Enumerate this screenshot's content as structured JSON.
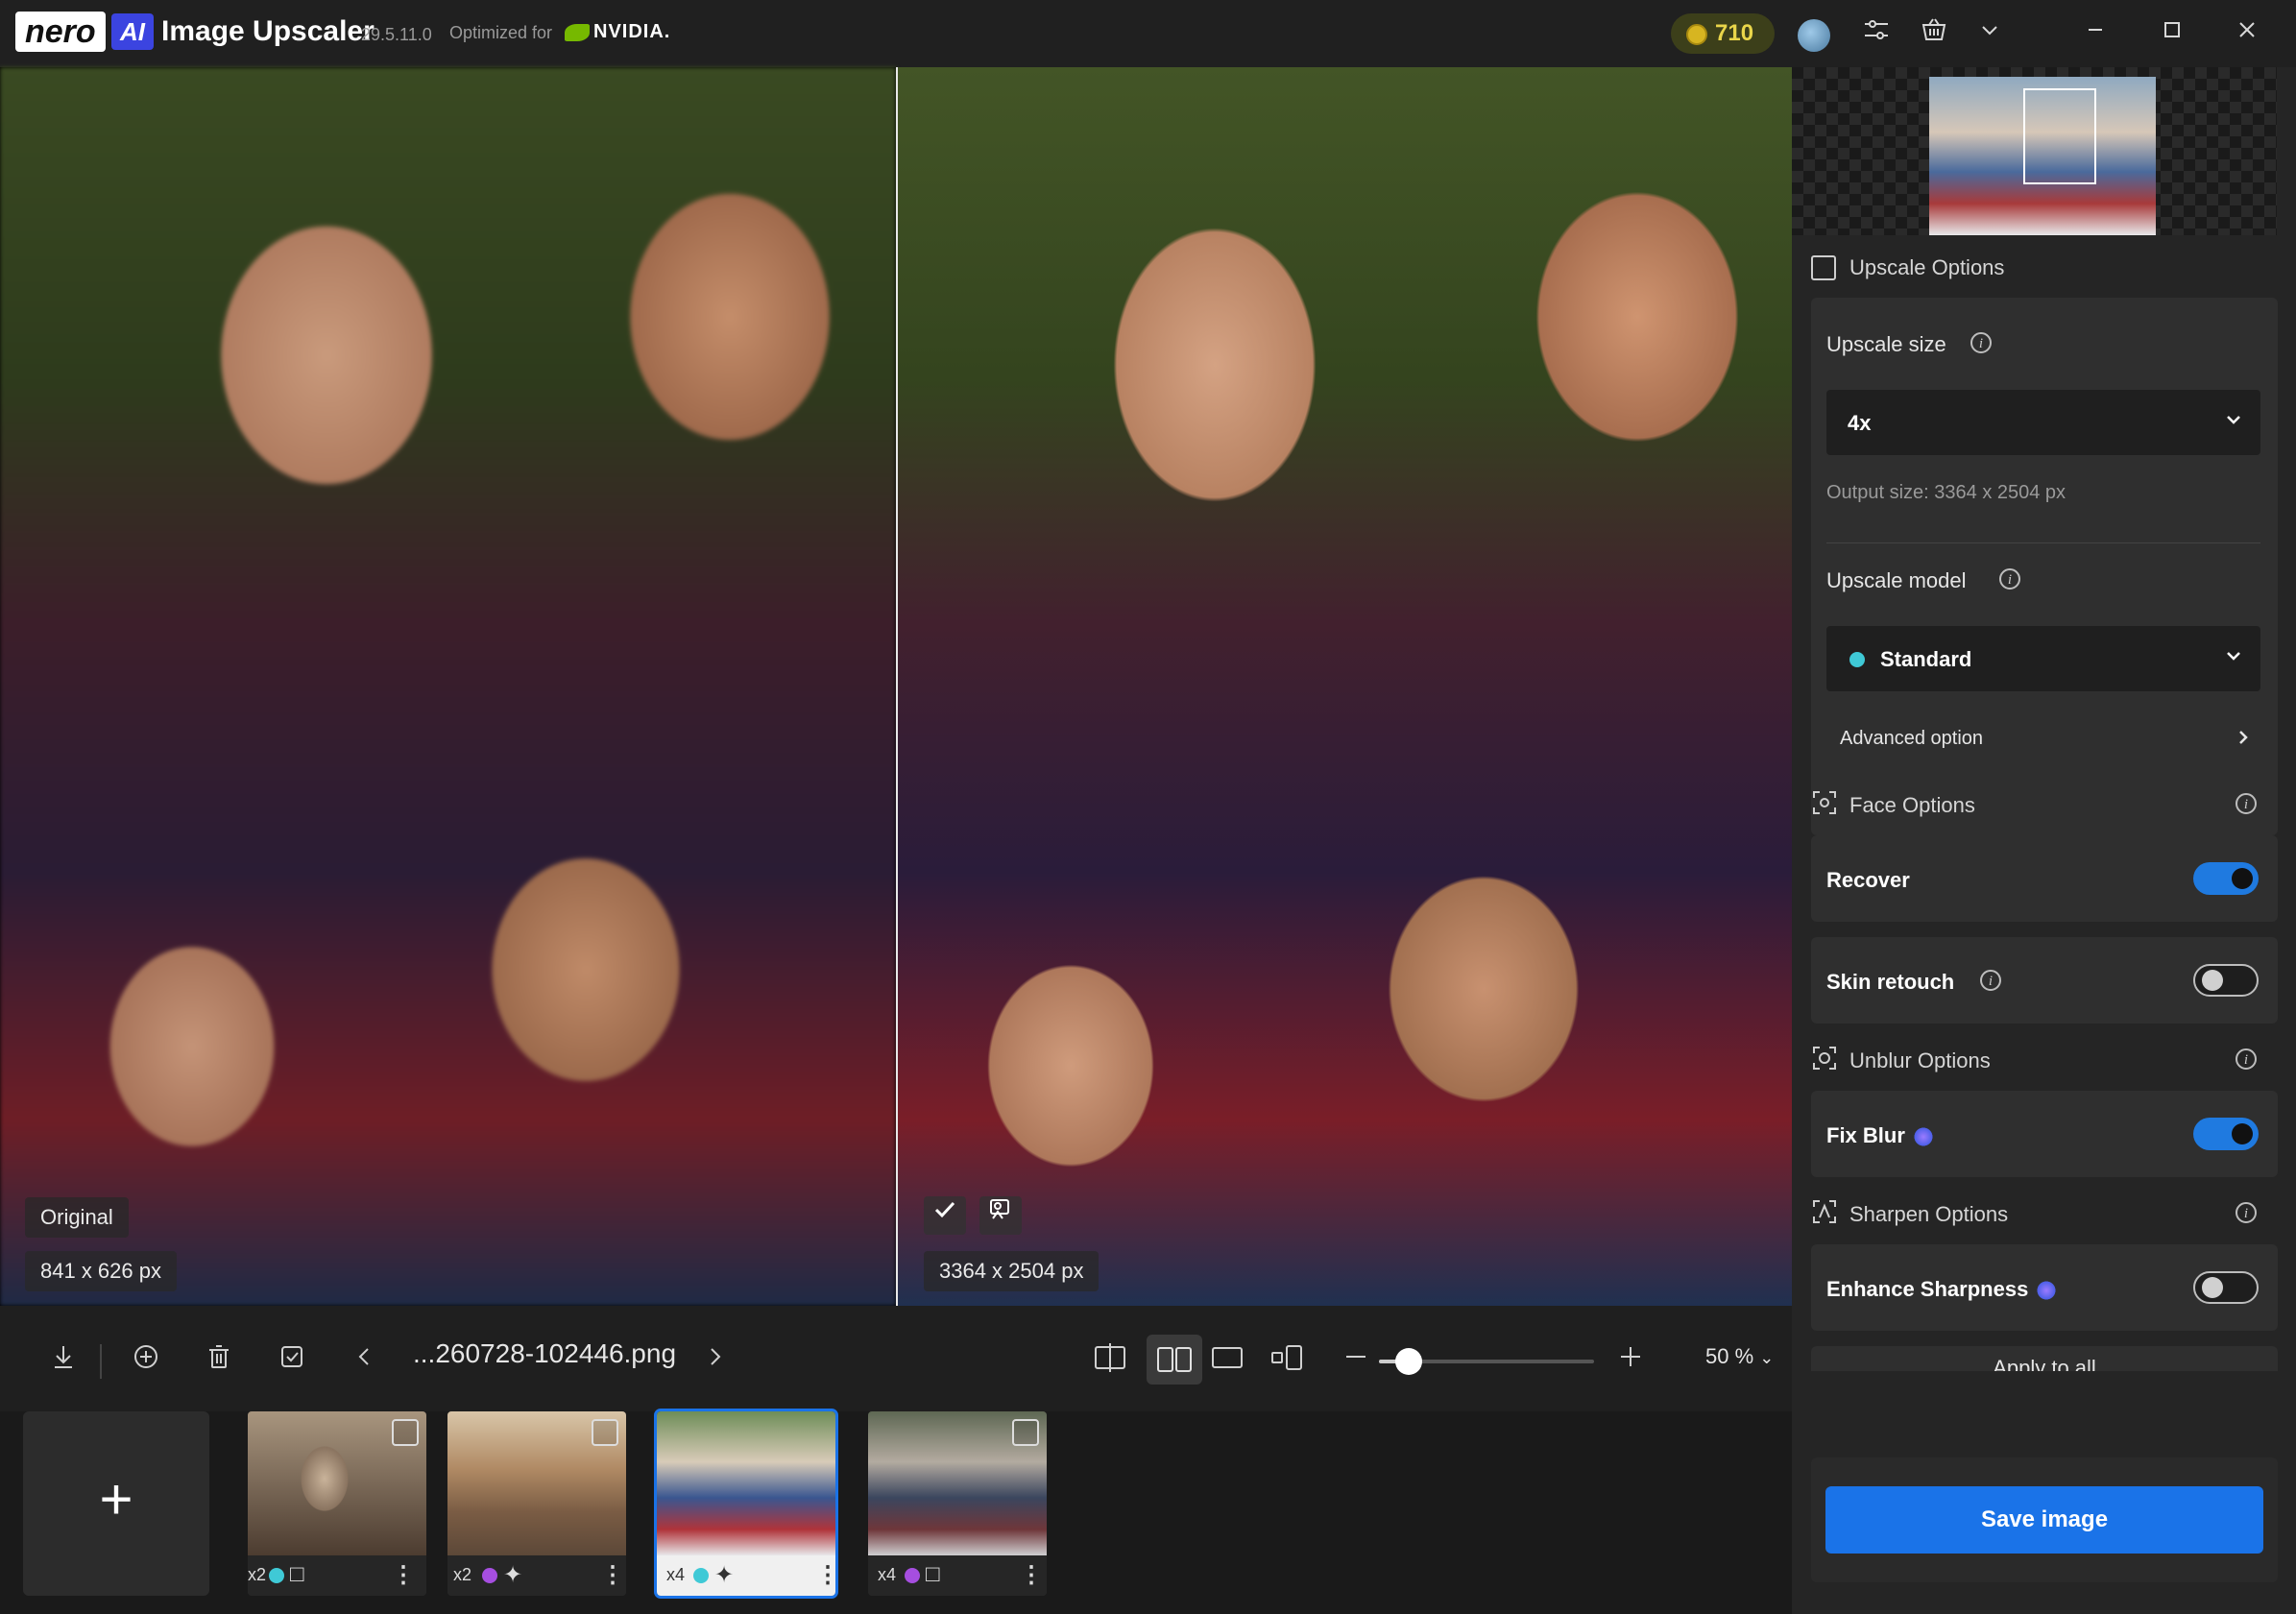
{
  "titlebar": {
    "brand": "nero",
    "ai_badge": "AI",
    "app_name": "Image Upscaler",
    "version": "29.5.11.0",
    "optimized_for": "Optimized for",
    "gpu_brand": "NVIDIA.",
    "credits": "710",
    "icons": [
      "settings-sliders-icon",
      "basket-icon",
      "chevron-down-icon",
      "minimize-icon",
      "maximize-icon",
      "close-icon"
    ]
  },
  "viewer": {
    "original_label": "Original",
    "original_size": "841 x 626 px",
    "result_size": "3364 x 2504 px"
  },
  "panel": {
    "upscale_options": {
      "title": "Upscale Options",
      "size_label": "Upscale size",
      "size_value": "4x",
      "output_size": "Output size: 3364 x 2504 px",
      "model_label": "Upscale model",
      "model_value": "Standard",
      "model_dot_color": "#3fc9d6",
      "advanced": "Advanced option"
    },
    "face_options": {
      "title": "Face Options",
      "recover_label": "Recover",
      "recover_on": true,
      "skin_label": "Skin retouch",
      "skin_on": false
    },
    "unblur_options": {
      "title": "Unblur Options",
      "fixblur_label": "Fix Blur",
      "fixblur_on": true
    },
    "sharpen_options": {
      "title": "Sharpen Options",
      "enhance_label": "Enhance Sharpness",
      "enhance_on": false
    },
    "apply_all": "Apply to all",
    "save": "Save image"
  },
  "toolbar": {
    "filename": "...260728-102446.png",
    "zoom": "50 %",
    "zoom_slider_fraction": 0.14
  },
  "thumbnails": [
    {
      "scale": "x2",
      "dot_color": "#3fc9d6",
      "selected": false
    },
    {
      "scale": "x2",
      "dot_color": "#a64ee0",
      "selected": false
    },
    {
      "scale": "x4",
      "dot_color": "#3fc9d6",
      "selected": true
    },
    {
      "scale": "x4",
      "dot_color": "#a64ee0",
      "selected": false
    }
  ],
  "colors": {
    "accent": "#1a73e8",
    "credits_text": "#e9d54a"
  }
}
